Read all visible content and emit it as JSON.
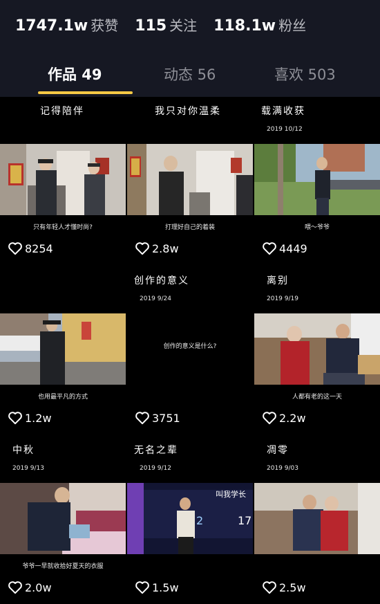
{
  "stats": {
    "likes_num": "1747.1w",
    "likes_label": "获赞",
    "following_num": "115",
    "following_label": "关注",
    "fans_num": "118.1w",
    "fans_label": "粉丝"
  },
  "tabs": [
    {
      "label": "作品 49"
    },
    {
      "label": "动态 56"
    },
    {
      "label": "喜欢 503"
    }
  ],
  "videos": [
    {
      "title": "记得陪伴",
      "date": "",
      "caption": "只有年轻人才懂时尚?",
      "likes": "8254"
    },
    {
      "title": "我只对你温柔",
      "date": "",
      "caption": "打理好自己的着装",
      "likes": "2.8w"
    },
    {
      "title": "载满收获",
      "date": "2019 10/12",
      "caption": "喂～爷爷",
      "likes": "4449"
    },
    {
      "title": "",
      "date": "",
      "caption": "也用最平凡的方式",
      "likes": "1.2w"
    },
    {
      "title": "创作的意义",
      "date": "2019 9/24",
      "caption": "创作的意义是什么?",
      "likes": "3751"
    },
    {
      "title": "离别",
      "date": "2019 9/19",
      "caption": "人都有老的这一天",
      "likes": "2.2w"
    },
    {
      "title": "中秋",
      "date": "2019 9/13",
      "caption": "爷爷一早就收拾好夏天的衣服",
      "likes": "2.0w"
    },
    {
      "title": "无名之辈",
      "date": "2019 9/12",
      "caption": "",
      "likes": "1.5w"
    },
    {
      "title": "凋零",
      "date": "2019 9/03",
      "caption": "",
      "likes": "2.5w"
    }
  ],
  "screen_text": {
    "stage_banner": "叫我学长",
    "stage_num_left": "2",
    "stage_num_right": "17"
  },
  "icons": {
    "like": "heart-outline-icon"
  }
}
